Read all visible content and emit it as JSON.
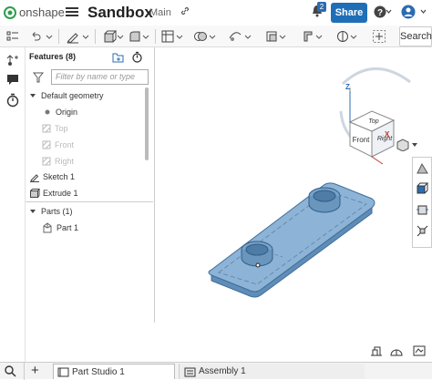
{
  "header": {
    "logo_text": "onshape",
    "doc_title": "Sandbox",
    "branch": "Main",
    "notification_count": "2",
    "share_label": "Share"
  },
  "toolbar": {
    "search_label": "Search"
  },
  "features": {
    "title": "Features (8)",
    "filter_placeholder": "Filter by name or type",
    "default_geometry": "Default geometry",
    "origin": "Origin",
    "top": "Top",
    "front": "Front",
    "right": "Right",
    "sketch": "Sketch 1",
    "extrude": "Extrude 1",
    "parts": "Parts (1)",
    "part": "Part 1"
  },
  "viewcube": {
    "top": "Top",
    "front": "Front",
    "right": "Right",
    "axis_z": "Z",
    "axis_x": "X"
  },
  "tabs": {
    "part_studio": "Part Studio 1",
    "assembly": "Assembly 1"
  },
  "colors": {
    "accent": "#1f6fb8",
    "part_fill": "#7fa9cf",
    "part_edge": "#3f6f9a"
  }
}
